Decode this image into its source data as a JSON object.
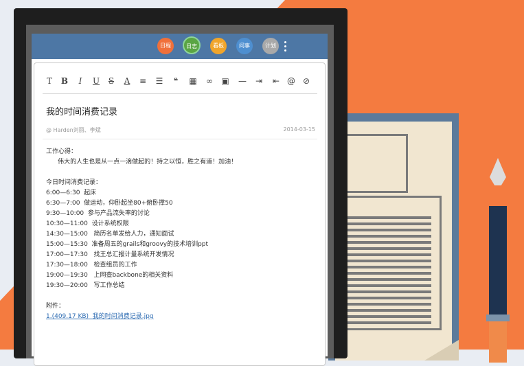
{
  "colors": {
    "header": "#4d77a5",
    "orange": "#f47b40",
    "link": "#2f6db3"
  },
  "nav": [
    {
      "label": "日程",
      "color": "#f0703a",
      "active": false
    },
    {
      "label": "日志",
      "color": "#5aa544",
      "active": true
    },
    {
      "label": "看板",
      "color": "#f0a52b",
      "active": false
    },
    {
      "label": "问事",
      "color": "#4e8fd0",
      "active": false
    },
    {
      "label": "计划",
      "color": "#a9a9a9",
      "active": false
    }
  ],
  "toolbar": [
    {
      "name": "bold-T-icon",
      "glyph": "T"
    },
    {
      "name": "bold-icon",
      "glyph": "B"
    },
    {
      "name": "italic-icon",
      "glyph": "I"
    },
    {
      "name": "underline-icon",
      "glyph": "U"
    },
    {
      "name": "strikethrough-icon",
      "glyph": "S"
    },
    {
      "name": "font-color-icon",
      "glyph": "A"
    },
    {
      "name": "ordered-list-icon",
      "glyph": "≡"
    },
    {
      "name": "unordered-list-icon",
      "glyph": "☰"
    },
    {
      "name": "quote-icon",
      "glyph": "❝"
    },
    {
      "name": "table-icon",
      "glyph": "▦"
    },
    {
      "name": "link-icon",
      "glyph": "∞"
    },
    {
      "name": "image-icon",
      "glyph": "▣"
    },
    {
      "name": "horizontal-rule-icon",
      "glyph": "—"
    },
    {
      "name": "indent-icon",
      "glyph": "⇥"
    },
    {
      "name": "outdent-icon",
      "glyph": "⇤"
    },
    {
      "name": "mention-icon",
      "glyph": "@"
    },
    {
      "name": "attachment-icon",
      "glyph": "⊘"
    }
  ],
  "post": {
    "title": "我的时间消费记录",
    "meta": "@ Harden刘丽、李斌",
    "date": "2014-03-15",
    "lines": [
      "工作心得：",
      "      伟大的人生也是从一点一滴做起的！持之以恒，胜之有道！加油！",
      "",
      "今日时间消费记录：",
      "6:00—6:30  起床",
      "6:30—7:00  做运动，仰卧起坐80+俯卧撑50",
      "9:30—10:00  参与产品流失率的讨论",
      "10:30—11:00  设计系统权限",
      "14:30—15:00   简历名单发给人力，通知面试",
      "15:00—15:30  准备周五的grails和groovy的技术培训ppt",
      "17:00—17:30   找王总汇报计量系统开发情况",
      "17:30—18:00   检查组员的工作",
      "19:00—19:30   上网查backbone的相关资料",
      "19:30—20:00   写工作总结",
      "",
      "附件："
    ],
    "attachment": "1.(409.17 KB)  我的时间消费记录.jpg"
  }
}
